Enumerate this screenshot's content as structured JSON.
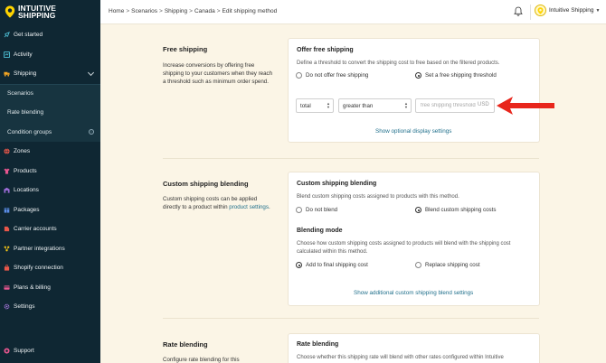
{
  "brand": {
    "line1": "INTUITIVE",
    "line2": "SHIPPING"
  },
  "sidebar": {
    "items": [
      {
        "label": "Get started"
      },
      {
        "label": "Activity"
      },
      {
        "label": "Shipping"
      },
      {
        "label": "Scenarios"
      },
      {
        "label": "Rate blending"
      },
      {
        "label": "Condition groups"
      },
      {
        "label": "Zones"
      },
      {
        "label": "Products"
      },
      {
        "label": "Locations"
      },
      {
        "label": "Packages"
      },
      {
        "label": "Carrier accounts"
      },
      {
        "label": "Partner integrations"
      },
      {
        "label": "Shopify connection"
      },
      {
        "label": "Plans & billing"
      },
      {
        "label": "Settings"
      }
    ],
    "support": "Support"
  },
  "header": {
    "breadcrumbs": [
      "Home",
      "Scenarios",
      "Shipping",
      "Canada",
      "Edit shipping method"
    ],
    "account_name": "Intuitive Shipping"
  },
  "free_shipping": {
    "title": "Free shipping",
    "desc": "Increase conversions by offering free shipping to your customers when they reach a threshold such as minimum order spend.",
    "card_title": "Offer free shipping",
    "card_desc": "Define a threshold to convert the shipping cost to free based on the filtered products.",
    "opt_no": "Do not offer free shipping",
    "opt_yes": "Set a free shipping threshold",
    "select_field": "total",
    "select_operator": "greater than",
    "threshold_placeholder": "free shipping threshold",
    "threshold_unit": "USD",
    "link": "Show optional display settings"
  },
  "custom_blending": {
    "title": "Custom shipping blending",
    "desc_part1": "Custom shipping costs can be applied directly to a product within ",
    "desc_link": "product settings",
    "desc_part2": ".",
    "card_title": "Custom shipping blending",
    "card_desc": "Blend custom shipping costs assigned to products with this method.",
    "opt_no": "Do not blend",
    "opt_yes": "Blend custom shipping costs",
    "mode_title": "Blending mode",
    "mode_desc": "Choose how custom shipping costs assigned to products will blend with the shipping cost calculated within this method.",
    "mode_add": "Add to final shipping cost",
    "mode_replace": "Replace shipping cost",
    "link": "Show additional custom shipping blend settings"
  },
  "rate_blending": {
    "title": "Rate blending",
    "desc": "Configure rate blending for this",
    "card_title": "Rate blending",
    "card_desc": "Choose whether this shipping rate will blend with other rates configured within Intuitive"
  },
  "colors": {
    "sidebar_bg": "#0f2733",
    "page_bg": "#fbf5e6",
    "accent_link": "#1f6f8b",
    "arrow": "#e8261c",
    "brand_yellow": "#ffd400"
  }
}
